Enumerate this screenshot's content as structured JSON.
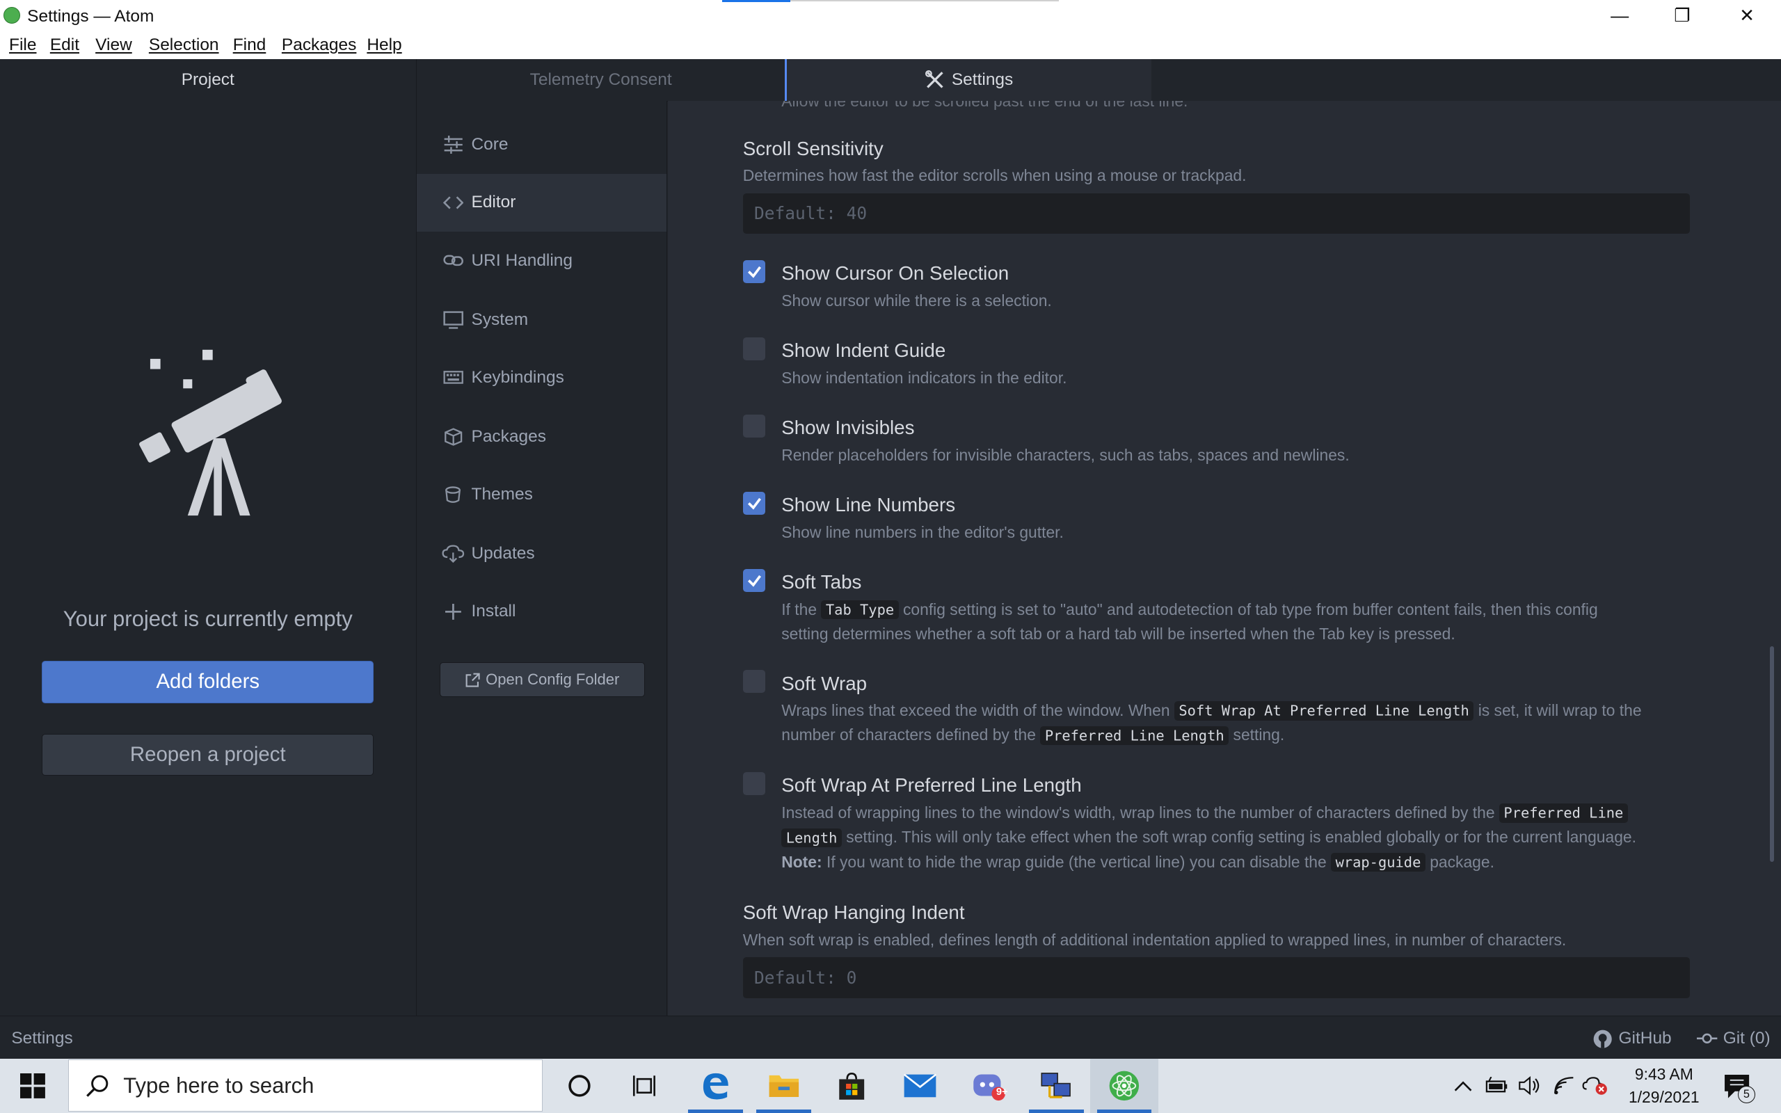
{
  "window": {
    "title": "Settings — Atom",
    "controls": {
      "minimize": "—",
      "maximize": "❐",
      "close": "✕"
    }
  },
  "menu": [
    "File",
    "Edit",
    "View",
    "Selection",
    "Find",
    "Packages",
    "Help"
  ],
  "project_panel": {
    "header": "Project",
    "empty_message": "Your project is currently empty",
    "add_folders": "Add folders",
    "reopen": "Reopen a project"
  },
  "tabs": [
    {
      "label": "Telemetry Consent",
      "active": false
    },
    {
      "label": "Settings",
      "active": true
    }
  ],
  "settings_nav": {
    "items": [
      {
        "label": "Core",
        "icon": "sliders-icon",
        "active": false
      },
      {
        "label": "Editor",
        "icon": "code-icon",
        "active": true
      },
      {
        "label": "URI Handling",
        "icon": "link-icon",
        "active": false
      },
      {
        "label": "System",
        "icon": "monitor-icon",
        "active": false
      },
      {
        "label": "Keybindings",
        "icon": "keyboard-icon",
        "active": false
      },
      {
        "label": "Packages",
        "icon": "package-icon",
        "active": false
      },
      {
        "label": "Themes",
        "icon": "paintcan-icon",
        "active": false
      },
      {
        "label": "Updates",
        "icon": "cloud-download-icon",
        "active": false
      },
      {
        "label": "Install",
        "icon": "plus-icon",
        "active": false
      }
    ],
    "open_config": "Open Config Folder"
  },
  "settings": {
    "cut_off_text": "Allow the editor to be scrolled past the end of the last line.",
    "scroll_sensitivity": {
      "title": "Scroll Sensitivity",
      "desc": "Determines how fast the editor scrolls when using a mouse or trackpad.",
      "placeholder": "Default: 40"
    },
    "show_cursor_on_selection": {
      "title": "Show Cursor On Selection",
      "desc": "Show cursor while there is a selection.",
      "checked": true
    },
    "show_indent_guide": {
      "title": "Show Indent Guide",
      "desc": "Show indentation indicators in the editor.",
      "checked": false
    },
    "show_invisibles": {
      "title": "Show Invisibles",
      "desc": "Render placeholders for invisible characters, such as tabs, spaces and newlines.",
      "checked": false
    },
    "show_line_numbers": {
      "title": "Show Line Numbers",
      "desc": "Show line numbers in the editor's gutter.",
      "checked": true
    },
    "soft_tabs": {
      "title": "Soft Tabs",
      "checked": true,
      "d1": "If the",
      "c1": "Tab Type",
      "d2": "config setting is set to \"auto\" and autodetection of tab type from buffer content fails, then this config",
      "d3": "setting determines whether a soft tab or a hard tab will be inserted when the Tab key is pressed."
    },
    "soft_wrap": {
      "title": "Soft Wrap",
      "checked": false,
      "d1": "Wraps lines that exceed the width of the window. When",
      "c1": "Soft Wrap At Preferred Line Length",
      "d2": "is set, it will wrap to the",
      "d3": "number of characters defined by the",
      "c2": "Preferred Line Length",
      "d4": "setting."
    },
    "soft_wrap_at_pll": {
      "title": "Soft Wrap At Preferred Line Length",
      "checked": false,
      "d1": "Instead of wrapping lines to the window's width, wrap lines to the number of characters defined by the",
      "c1a": "Preferred Line",
      "c1b": "Length",
      "d2": "setting. This will only take effect when the soft wrap config setting is enabled globally or for the current language.",
      "note_label": "Note:",
      "d3": "If you want to hide the wrap guide (the vertical line) you can disable the",
      "c2": "wrap-guide",
      "d4": "package."
    },
    "soft_wrap_hanging_indent": {
      "title": "Soft Wrap Hanging Indent",
      "desc": "When soft wrap is enabled, defines length of additional indentation applied to wrapped lines, in number of characters.",
      "placeholder": "Default: 0"
    }
  },
  "statusbar": {
    "left": "Settings",
    "github": "GitHub",
    "git": "Git (0)"
  },
  "taskbar": {
    "search_placeholder": "Type here to search",
    "time": "9:43 AM",
    "date": "1/29/2021",
    "notification_count": "5",
    "discord_badge": "9+"
  }
}
